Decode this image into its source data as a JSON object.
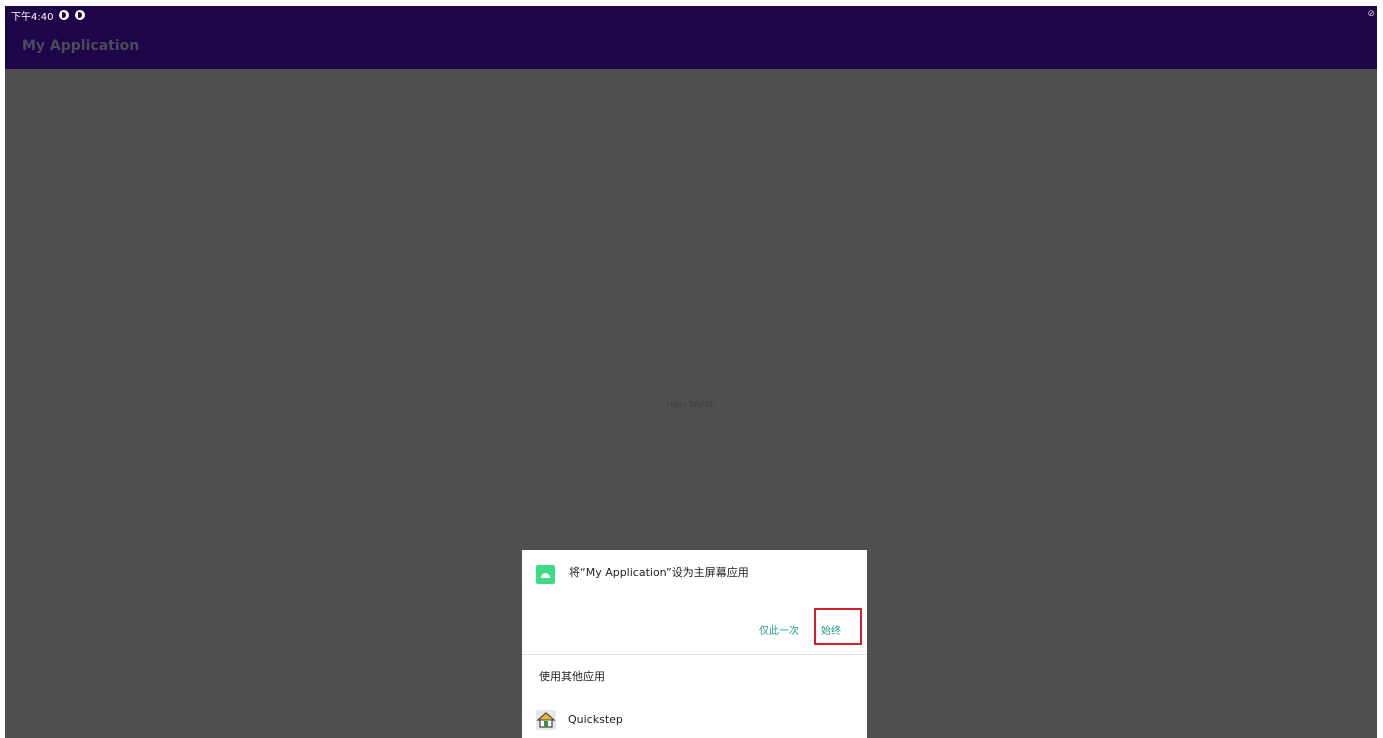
{
  "status_bar": {
    "time": "下午4:40",
    "icons": [
      "sync-icon",
      "sync-icon"
    ]
  },
  "app_bar": {
    "title": "My Application"
  },
  "main": {
    "text": "Hello World!"
  },
  "dialog": {
    "title": "将“My Application”设为主屏幕应用",
    "just_once_label": "仅此一次",
    "always_label": "始终",
    "use_other_label": "使用其他应用",
    "apps": [
      {
        "name": "Quickstep",
        "icon": "home-icon"
      }
    ]
  },
  "colors": {
    "app_bar": "#1e0547",
    "scrim_background": "#505050",
    "accent": "#1f9e8a",
    "highlight_box": "#d0202e",
    "android_green": "#3ddc84"
  }
}
